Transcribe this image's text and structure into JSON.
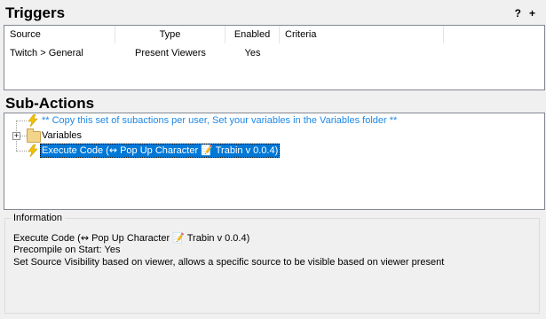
{
  "triggers": {
    "title": "Triggers",
    "help_label": "?",
    "add_label": "+",
    "columns": [
      "Source",
      "Type",
      "Enabled",
      "Criteria"
    ],
    "rows": [
      {
        "source": "Twitch > General",
        "type": "Present Viewers",
        "enabled": "Yes",
        "criteria": ""
      }
    ]
  },
  "subactions": {
    "title": "Sub-Actions",
    "items": [
      {
        "label": "** Copy this set of subactions per user, Set your variables in the Variables folder **",
        "icon": "lightning-icon",
        "color": "#1e88e5"
      },
      {
        "label": "Variables",
        "icon": "folder-icon",
        "expander": "+"
      },
      {
        "label": "Execute Code (↭ Pop Up Character 📝 Trabin v 0.0.4)",
        "icon": "lightning-icon",
        "selected": true
      }
    ]
  },
  "information": {
    "legend": "Information",
    "lines": [
      "Execute Code (↭ Pop Up Character 📝 Trabin v 0.0.4)",
      "Precompile on Start: Yes",
      "Set Source Visibility based on viewer, allows a specific source to be visible based on viewer present"
    ]
  },
  "colors": {
    "selection": "#0078d7",
    "comment_text": "#1e88e5",
    "bolt": "#f2c200"
  }
}
